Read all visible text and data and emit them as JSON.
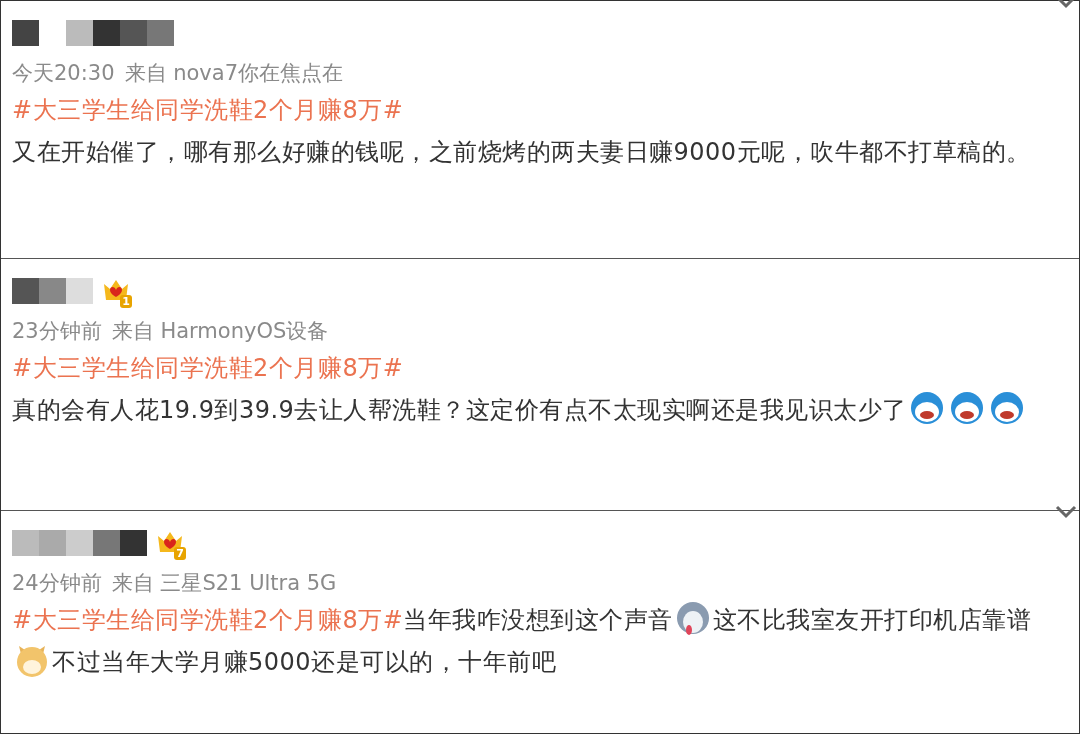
{
  "comments": [
    {
      "menu": true,
      "meta": [
        "今天20:30",
        "来自 nova7你在焦点在"
      ],
      "body": [
        {
          "kind": "hashtag",
          "text": "#大三学生给同学洗鞋2个月赚8万#"
        },
        {
          "kind": "break"
        },
        {
          "kind": "text",
          "text": "又在开始催了，哪有那么好赚的钱呢，之前烧烤的两夫妻日赚9000元呢，吹牛都不打草稿的。"
        }
      ]
    },
    {
      "badge": "1",
      "menu": false,
      "meta": [
        "23分钟前",
        "来自 HarmonyOS设备"
      ],
      "body": [
        {
          "kind": "hashtag",
          "text": "#大三学生给同学洗鞋2个月赚8万#"
        },
        {
          "kind": "break"
        },
        {
          "kind": "text",
          "text": "真的会有人花19.9到39.9去让人帮洗鞋？这定价有点不太现实啊还是我见识太少了"
        },
        {
          "kind": "blue-emoji"
        },
        {
          "kind": "blue-emoji"
        },
        {
          "kind": "blue-emoji"
        }
      ]
    },
    {
      "badge": "7",
      "menu": true,
      "meta": [
        "24分钟前",
        "来自 三星S21 Ultra 5G"
      ],
      "body": [
        {
          "kind": "hashtag",
          "text": "#大三学生给同学洗鞋2个月赚8万#"
        },
        {
          "kind": "text",
          "text": "当年我咋没想到这个声音"
        },
        {
          "kind": "husky-emoji"
        },
        {
          "kind": "text",
          "text": "这不比我室友开打印机店靠谱"
        },
        {
          "kind": "shiba-emoji"
        },
        {
          "kind": "text",
          "text": "不过当年大学月赚5000还是可以的，十年前吧"
        }
      ]
    }
  ]
}
